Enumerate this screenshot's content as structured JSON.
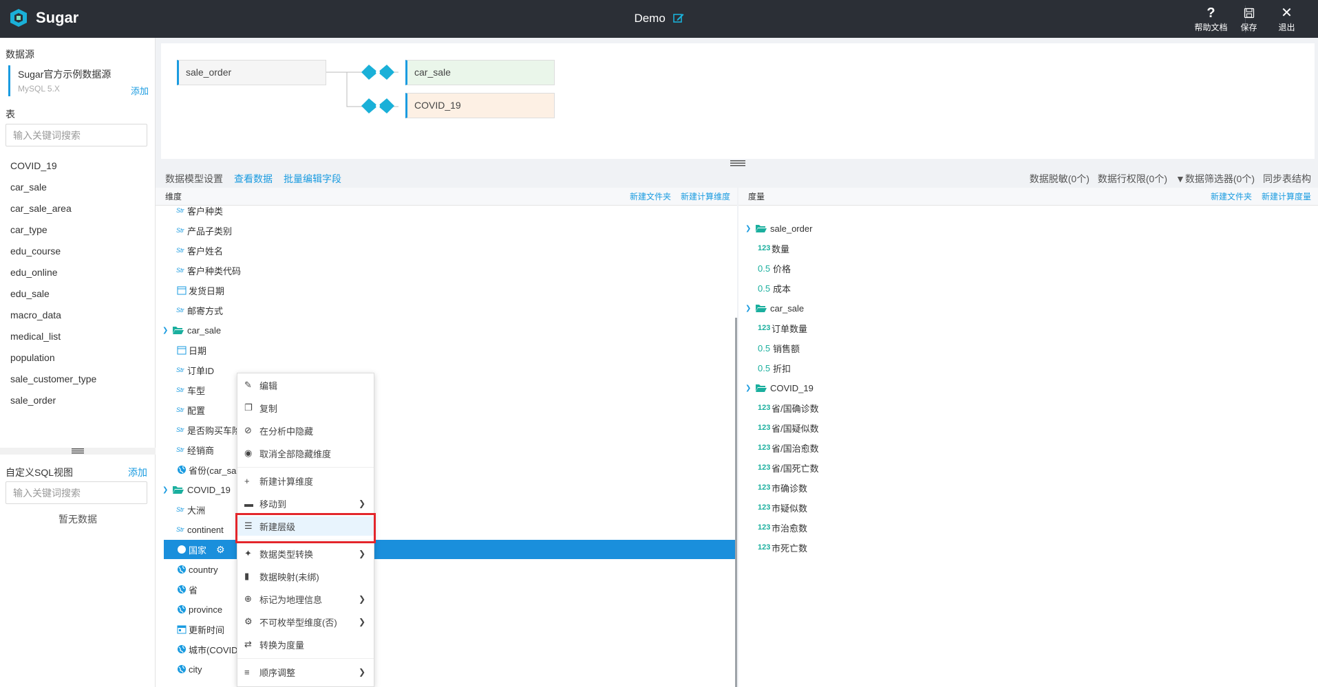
{
  "app": {
    "name": "Sugar",
    "title": "Demo"
  },
  "top_actions": [
    {
      "label": "帮助文档",
      "icon": "help-icon"
    },
    {
      "label": "保存",
      "icon": "save-icon"
    },
    {
      "label": "退出",
      "icon": "close-icon"
    }
  ],
  "sidebar": {
    "datasource_title": "数据源",
    "datasource_name": "Sugar官方示例数据源",
    "datasource_type": "MySQL 5.X",
    "add_label": "添加",
    "table_title": "表",
    "search_placeholder": "输入关键词搜索",
    "tables": [
      "COVID_19",
      "car_sale",
      "car_sale_area",
      "car_type",
      "edu_course",
      "edu_online",
      "edu_sale",
      "macro_data",
      "medical_list",
      "population",
      "sale_customer_type",
      "sale_order"
    ],
    "sql_title": "自定义SQL视图",
    "sql_add": "添加",
    "sql_search_placeholder": "输入关键词搜索",
    "sql_empty": "暂无数据"
  },
  "diagram": {
    "main": "sale_order",
    "joins": [
      "car_sale",
      "COVID_19"
    ],
    "colors": {
      "car_sale": "#eaf6ea",
      "COVID_19": "#fdf0e4",
      "sale_order": "#f5f5f5",
      "join": "#1ab0d8"
    }
  },
  "toolbar": {
    "settings": "数据模型设置",
    "view_data": "查看数据",
    "batch_edit": "批量编辑字段",
    "mask": "数据脱敏(0个)",
    "row_perm": "数据行权限(0个)",
    "filter": "数据筛选器(0个)",
    "sync": "同步表结构"
  },
  "dimensions": {
    "title": "维度",
    "new_folder": "新建文件夹",
    "new_calc": "新建计算维度",
    "items": [
      {
        "type": "Str",
        "label": "客户种类"
      },
      {
        "type": "Str",
        "label": "产品子类别"
      },
      {
        "type": "Str",
        "label": "客户姓名"
      },
      {
        "type": "Str",
        "label": "客户种类代码"
      },
      {
        "type": "date",
        "label": "发货日期"
      },
      {
        "type": "Str",
        "label": "邮寄方式"
      },
      {
        "type": "folder",
        "label": "car_sale"
      },
      {
        "type": "date",
        "label": "日期"
      },
      {
        "type": "Str",
        "label": "订单ID"
      },
      {
        "type": "Str",
        "label": "车型"
      },
      {
        "type": "Str",
        "label": "配置"
      },
      {
        "type": "Str",
        "label": "是否购买车险"
      },
      {
        "type": "Str",
        "label": "经销商"
      },
      {
        "type": "geo",
        "label": "省份(car_sale)"
      },
      {
        "type": "folder",
        "label": "COVID_19"
      },
      {
        "type": "Str",
        "label": "大洲"
      },
      {
        "type": "Str",
        "label": "continent"
      },
      {
        "type": "geo",
        "label": "国家"
      },
      {
        "type": "geo",
        "label": "country"
      },
      {
        "type": "geo",
        "label": "省"
      },
      {
        "type": "geo",
        "label": "province"
      },
      {
        "type": "datetime",
        "label": "更新时间"
      },
      {
        "type": "geo",
        "label": "城市(COVID_19)"
      },
      {
        "type": "geo",
        "label": "city"
      }
    ]
  },
  "measures": {
    "title": "度量",
    "new_folder": "新建文件夹",
    "new_calc": "新建计算度量",
    "items": [
      {
        "type": "folder",
        "label": "sale_order"
      },
      {
        "type": "123",
        "label": "数量"
      },
      {
        "type": "0.5",
        "label": "价格"
      },
      {
        "type": "0.5",
        "label": "成本"
      },
      {
        "type": "folder",
        "label": "car_sale"
      },
      {
        "type": "123",
        "label": "订单数量"
      },
      {
        "type": "0.5",
        "label": "销售额"
      },
      {
        "type": "0.5",
        "label": "折扣"
      },
      {
        "type": "folder",
        "label": "COVID_19"
      },
      {
        "type": "123",
        "label": "省/国确诊数"
      },
      {
        "type": "123",
        "label": "省/国疑似数"
      },
      {
        "type": "123",
        "label": "省/国治愈数"
      },
      {
        "type": "123",
        "label": "省/国死亡数"
      },
      {
        "type": "123",
        "label": "市确诊数"
      },
      {
        "type": "123",
        "label": "市疑似数"
      },
      {
        "type": "123",
        "label": "市治愈数"
      },
      {
        "type": "123",
        "label": "市死亡数"
      }
    ]
  },
  "context_menu": [
    {
      "label": "编辑",
      "icon": "edit-icon"
    },
    {
      "label": "复制",
      "icon": "copy-icon"
    },
    {
      "label": "在分析中隐藏",
      "icon": "eye-slash-icon"
    },
    {
      "label": "取消全部隐藏维度",
      "icon": "eye-icon"
    },
    {
      "label": "新建计算维度",
      "icon": "plus-icon"
    },
    {
      "label": "移动到",
      "icon": "folder-icon",
      "sub": true
    },
    {
      "label": "新建层级",
      "icon": "hierarchy-icon",
      "highlight": true
    },
    {
      "label": "数据类型转换",
      "icon": "wand-icon",
      "sub": true
    },
    {
      "label": "数据映射(未绑)",
      "icon": "book-icon"
    },
    {
      "label": "标记为地理信息",
      "icon": "globe-icon",
      "sub": true
    },
    {
      "label": "不可枚举型维度(否)",
      "icon": "gear-icon",
      "sub": true
    },
    {
      "label": "转换为度量",
      "icon": "swap-icon"
    },
    {
      "label": "顺序调整",
      "icon": "list-icon",
      "sub": true
    }
  ]
}
